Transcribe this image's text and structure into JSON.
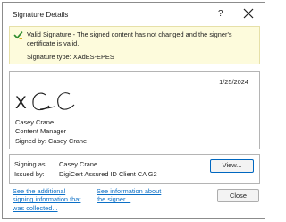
{
  "dialog": {
    "title": "Signature Details",
    "help_label": "?",
    "close_icon": "close-icon"
  },
  "banner": {
    "icon": "checkmark-shield-icon",
    "message_line1": "Valid Signature - The signed content has not changed and the signer's",
    "message_line2": "certificate is valid.",
    "signature_type": "Signature type: XAdES-EPES"
  },
  "signature": {
    "date": "1/25/2024",
    "x_mark": "X",
    "signer_name": "Casey Crane",
    "signer_title": "Content Manager",
    "signed_by": "Signed by: Casey Crane"
  },
  "details": {
    "signing_as_label": "Signing as:",
    "signing_as_value": "Casey Crane",
    "issued_by_label": "Issued by:",
    "issued_by_value": "DigiCert Assured ID Client CA G2",
    "view_button": "View..."
  },
  "links": {
    "additional_line1": "See the additional",
    "additional_line2": "signing information that",
    "additional_line3": "was collected...",
    "signer_line1": "See information about",
    "signer_line2": "the signer..."
  },
  "footer": {
    "close_button": "Close"
  },
  "colors": {
    "banner_bg": "#fdfbdc",
    "link": "#0b6fc6",
    "accent": "#0067c0",
    "check_green": "#2e8b2e"
  }
}
